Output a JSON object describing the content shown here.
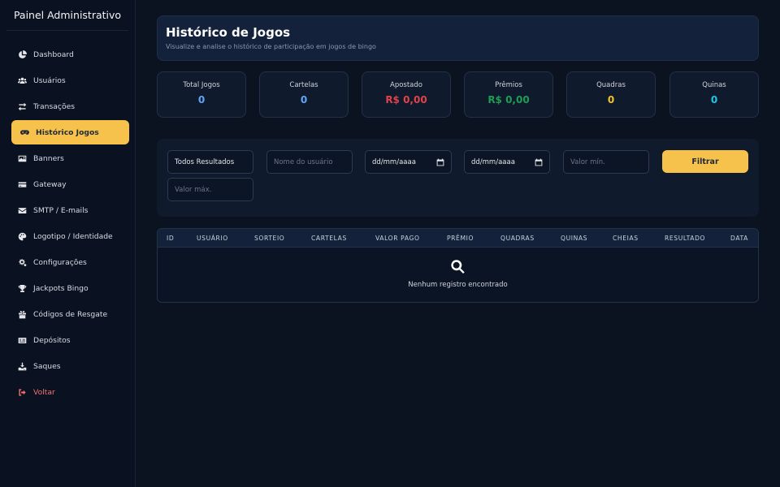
{
  "brand": "Painel Administrativo",
  "nav": [
    {
      "label": "Dashboard",
      "icon": "chart-pie-icon"
    },
    {
      "label": "Usuários",
      "icon": "users-icon"
    },
    {
      "label": "Transações",
      "icon": "exchange-icon"
    },
    {
      "label": "Histórico Jogos",
      "icon": "gamepad-icon",
      "active": true
    },
    {
      "label": "Banners",
      "icon": "image-icon"
    },
    {
      "label": "Gateway",
      "icon": "credit-card-icon"
    },
    {
      "label": "SMTP / E-mails",
      "icon": "envelope-icon"
    },
    {
      "label": "Logotipo / Identidade",
      "icon": "palette-icon"
    },
    {
      "label": "Configurações",
      "icon": "gears-icon"
    },
    {
      "label": "Jackpots Bingo",
      "icon": "trophy-icon"
    },
    {
      "label": "Códigos de Resgate",
      "icon": "gift-icon"
    },
    {
      "label": "Depósitos",
      "icon": "money-check-icon"
    },
    {
      "label": "Saques",
      "icon": "withdraw-icon"
    },
    {
      "label": "Voltar",
      "icon": "sign-out-icon"
    }
  ],
  "header": {
    "title": "Histórico de Jogos",
    "subtitle": "Visualize e analise o histórico de participação em jogos de bingo"
  },
  "stats": [
    {
      "label": "Total Jogos",
      "value": "0",
      "color": "#60a5fa"
    },
    {
      "label": "Cartelas",
      "value": "0",
      "color": "#60a5fa"
    },
    {
      "label": "Apostado",
      "value": "R$ 0,00",
      "color": "#e0424b"
    },
    {
      "label": "Prêmios",
      "value": "R$ 0,00",
      "color": "#1f9d55"
    },
    {
      "label": "Quadras",
      "value": "0",
      "color": "#f5c518"
    },
    {
      "label": "Quinas",
      "value": "0",
      "color": "#22c5e6"
    }
  ],
  "filters": {
    "result_select": "Todos Resultados",
    "user_placeholder": "Nome do usuário",
    "date_from": "dd/mm/aaaa",
    "date_to": "dd/mm/aaaa",
    "min_placeholder": "Valor mín.",
    "max_placeholder": "Valor máx.",
    "filter_button": "Filtrar"
  },
  "table": {
    "columns": [
      "ID",
      "USUÁRIO",
      "SORTEIO",
      "CARTELAS",
      "VALOR PAGO",
      "PRÊMIO",
      "QUADRAS",
      "QUINAS",
      "CHEIAS",
      "RESULTADO",
      "DATA"
    ],
    "empty_message": "Nenhum registro encontrado"
  },
  "colors": {
    "accent": "#f7c24c",
    "logout": "#f87171"
  }
}
